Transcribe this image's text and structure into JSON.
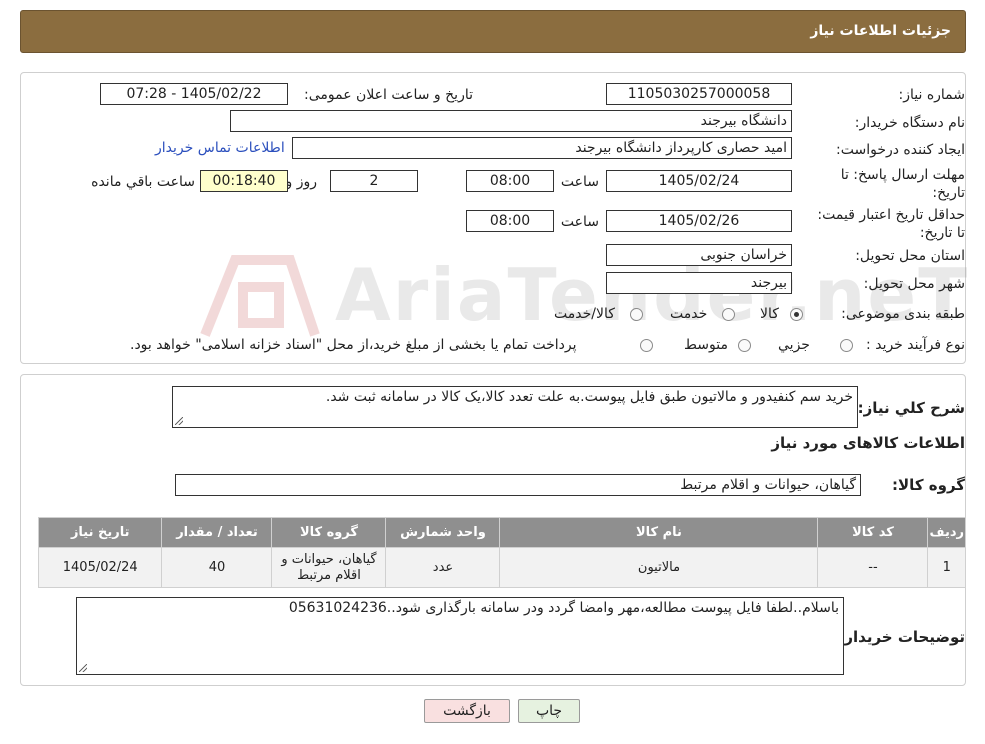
{
  "header": {
    "title": "جزئیات اطلاعات نیاز"
  },
  "form": {
    "need_number_label": "شماره نیاز:",
    "need_number": "1105030257000058",
    "announce_label": "تاریخ و ساعت اعلان عمومی:",
    "announce_value": "1405/02/22 - 07:28",
    "buyer_org_label": "نام دستگاه خریدار:",
    "buyer_org": "دانشگاه بیرجند",
    "requester_label": "ایجاد کننده درخواست:",
    "requester": "امید حصاری کارپرداز دانشگاه بیرجند",
    "contact_link": "اطلاعات تماس خریدار",
    "deadline_label": "مهلت ارسال پاسخ: تا تاریخ:",
    "deadline_date": "1405/02/24",
    "time_label": "ساعت",
    "deadline_time": "08:00",
    "days_value": "2",
    "days_label": "روز و",
    "remaining_value": "00:18:40",
    "remaining_label": "ساعت باقي مانده",
    "validity_label": "حداقل تاریخ اعتبار قیمت: تا تاریخ:",
    "validity_date": "1405/02/26",
    "validity_time": "08:00",
    "province_label": "استان محل تحویل:",
    "province": "خراسان جنوبی",
    "city_label": "شهر محل تحویل:",
    "city": "بیرجند",
    "category_label": "طبقه بندی موضوعی:",
    "category_options": [
      "کالا",
      "خدمت",
      "کالا/خدمت"
    ],
    "category_selected": 0,
    "process_label": "نوع فرآیند خرید :",
    "process_options": [
      "جزیي",
      "متوسط"
    ],
    "process_note": "پرداخت تمام یا بخشی از مبلغ خرید،از محل \"اسناد خزانه اسلامی\" خواهد بود."
  },
  "details": {
    "description_label": "شرح کلي نياز:",
    "description": "خرید سم کنفیدور و مالاتیون طبق فایل پیوست.به علت تعدد کالا،یک کالا در سامانه ثبت شد.",
    "goods_info_title": "اطلاعات کالاهای مورد نیاز",
    "goods_group_label": "گروه کالا:",
    "goods_group": "گیاهان، حیوانات و اقلام مرتبط"
  },
  "table": {
    "headers": [
      "ردیف",
      "کد کالا",
      "نام کالا",
      "واحد شمارش",
      "گروه کالا",
      "تعداد / مقدار",
      "تاریخ نیاز"
    ],
    "rows": [
      [
        "1",
        "--",
        "مالاتیون",
        "عدد",
        "گیاهان، حیوانات و اقلام مرتبط",
        "40",
        "1405/02/24"
      ]
    ]
  },
  "buyer_notes": {
    "label": "توضیحات خریدار:",
    "text": "باسلام..لطفا فایل پیوست مطالعه،مهر وامضا گردد ودر سامانه بارگذاری شود..05631024236"
  },
  "buttons": {
    "print": "چاپ",
    "back": "بازگشت"
  },
  "watermark_text": "AriaTender.neT",
  "colors": {
    "header": "#8b6d3f",
    "table_header": "#8f8f8f",
    "back_button": "#f9e0e0",
    "print_button": "#e6f2e0",
    "link": "#2b4fbd"
  }
}
